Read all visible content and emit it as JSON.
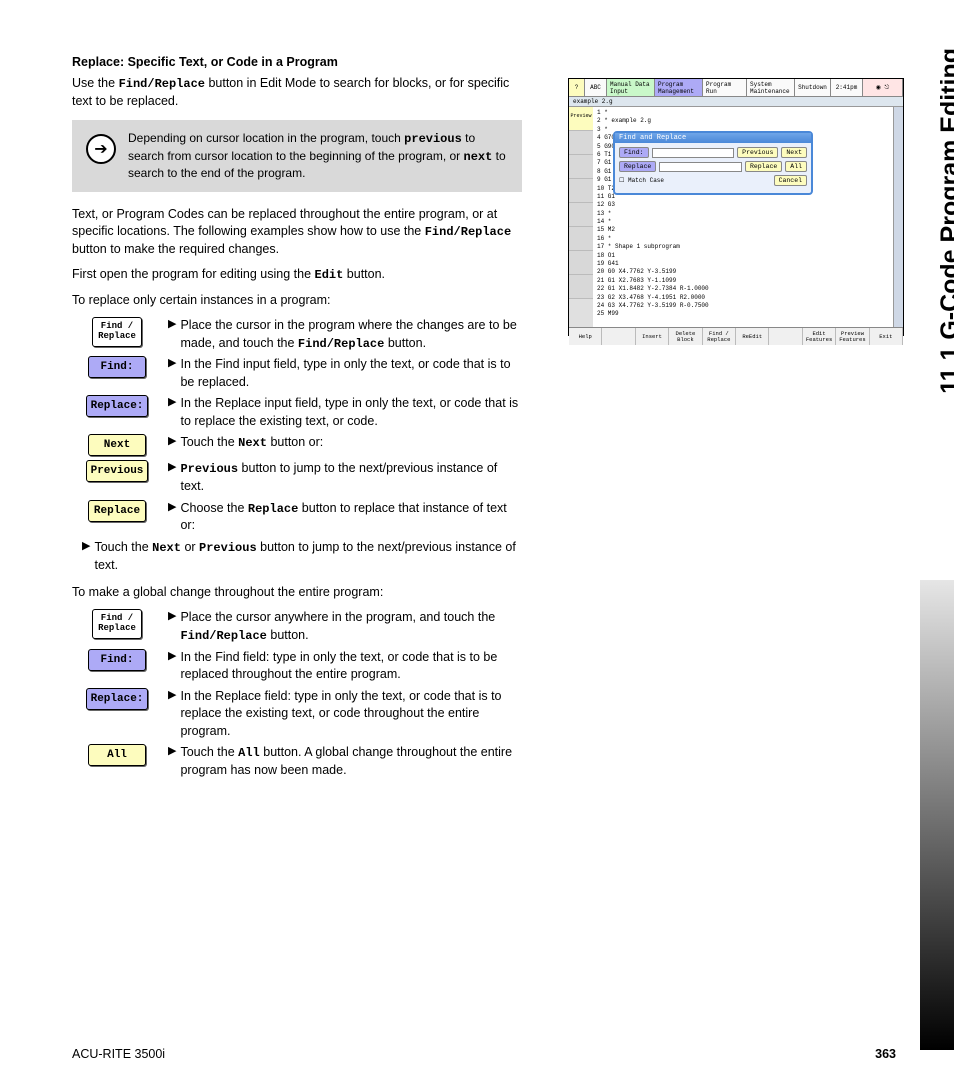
{
  "heading": "Replace: Specific Text, or Code in a Program",
  "intro": "Use the ",
  "intro_code": "Find/Replace",
  "intro2": " button in Edit Mode to search for blocks, or for specific text to be replaced.",
  "tip": {
    "t1": "Depending on cursor location in the program, touch ",
    "prev": "previous",
    "t2": " to search from cursor location to the beginning of the program, or ",
    "next": "next",
    "t3": " to search to the end of the program."
  },
  "para2a": "Text, or Program Codes can be replaced throughout the entire program, or at specific locations.  The following examples show how to use the ",
  "para2b": "Find/Replace",
  "para2c": " button to make the required changes.",
  "para3a": "First open the program for editing using the ",
  "para3b": "Edit",
  "para3c": " button.",
  "para4": "To replace only certain instances in a program:",
  "steps1": [
    {
      "btn": "Find /\nReplace",
      "cls": "small",
      "pre": "Place the cursor in the program where the changes are to be  made, and touch the ",
      "code": "Find/Replace",
      "post": " button."
    },
    {
      "btn": "Find:",
      "cls": "purple",
      "pre": "In the Find input field, type in only the text, or code that is to be replaced.",
      "code": "",
      "post": ""
    },
    {
      "btn": "Replace:",
      "cls": "purple",
      "pre": "In the Replace input field, type in only the text, or code that is to replace the existing text, or code.",
      "code": "",
      "post": ""
    },
    {
      "btn": "Next",
      "cls": "yellow",
      "pre": "Touch the ",
      "code": "Next",
      "post": " button or:"
    },
    {
      "btn": "Previous",
      "cls": "yellow",
      "pre": "",
      "code": "Previous",
      "post": " button to jump to the next/previous instance of text."
    },
    {
      "btn": "Replace",
      "cls": "yellow",
      "pre": "Choose the ",
      "code": "Replace",
      "post": " button to replace that instance of text or:"
    }
  ],
  "full1a": "Touch the ",
  "full1b": "Next",
  "full1c": " or ",
  "full1d": "Previous",
  "full1e": " button to jump to  the next/previous instance of text.",
  "para5": "To make a global change throughout the entire program:",
  "steps2": [
    {
      "btn": "Find /\nReplace",
      "cls": "small",
      "pre": "Place the cursor anywhere in the program, and touch the ",
      "code": "Find/Replace",
      "post": " button."
    },
    {
      "btn": "Find:",
      "cls": "purple",
      "pre": "In the Find field: type in only the text, or code that is to be replaced throughout the entire program.",
      "code": "",
      "post": ""
    },
    {
      "btn": "Replace:",
      "cls": "purple",
      "pre": "In the Replace field: type in only the text, or code that is to replace the existing text, or code throughout the entire program.",
      "code": "",
      "post": ""
    },
    {
      "btn": "All",
      "cls": "yellow",
      "pre": "Touch the ",
      "code": "All",
      "post": " button. A global change throughout the entire program has now been made."
    }
  ],
  "footer_left": "ACU-RITE 3500i",
  "footer_right": "363",
  "side_title": "11.1 G-Code Program Editing",
  "ss": {
    "top": [
      "?",
      "ABC",
      "Manual Data Input",
      "Program Management",
      "Program Run",
      "System Maintenance",
      "Shutdown",
      "2:41pm"
    ],
    "tabtitle": "example 2.g",
    "lines": [
      "1  *",
      "2  * example 2.g",
      "3  *",
      "4  G70",
      "5  G90",
      "6  T1",
      "7  G1",
      "8  G1",
      "9  G1",
      "10 T2",
      "11 G1",
      "12 G3",
      "13 *",
      "14 *",
      "15 M2",
      "16 *",
      "17 * Shape 1 subprogram",
      "18 O1",
      "19 G41",
      "20 G0 X4.7762 Y-3.5199",
      "21 G1 X2.7683 Y-1.1099",
      "22 G1 X1.8482 Y-2.7384 R-1.0000",
      "23 G2 X3.4768 Y-4.1951 R2.0000",
      "24 G3 X4.7762 Y-3.5199 R-0.7500",
      "25 M99"
    ],
    "dlg_title": "Find and Replace",
    "find": "Find:",
    "replace": "Replace",
    "prev": "Previous",
    "next": "Next",
    "all": "All",
    "match": "Match Case",
    "cancel": "Cancel",
    "bottom": [
      "Help",
      "",
      "Insert",
      "Delete Block",
      "Find / Replace",
      "ReEdit",
      "",
      "Edit Features",
      "Preview Features",
      "Exit"
    ]
  }
}
